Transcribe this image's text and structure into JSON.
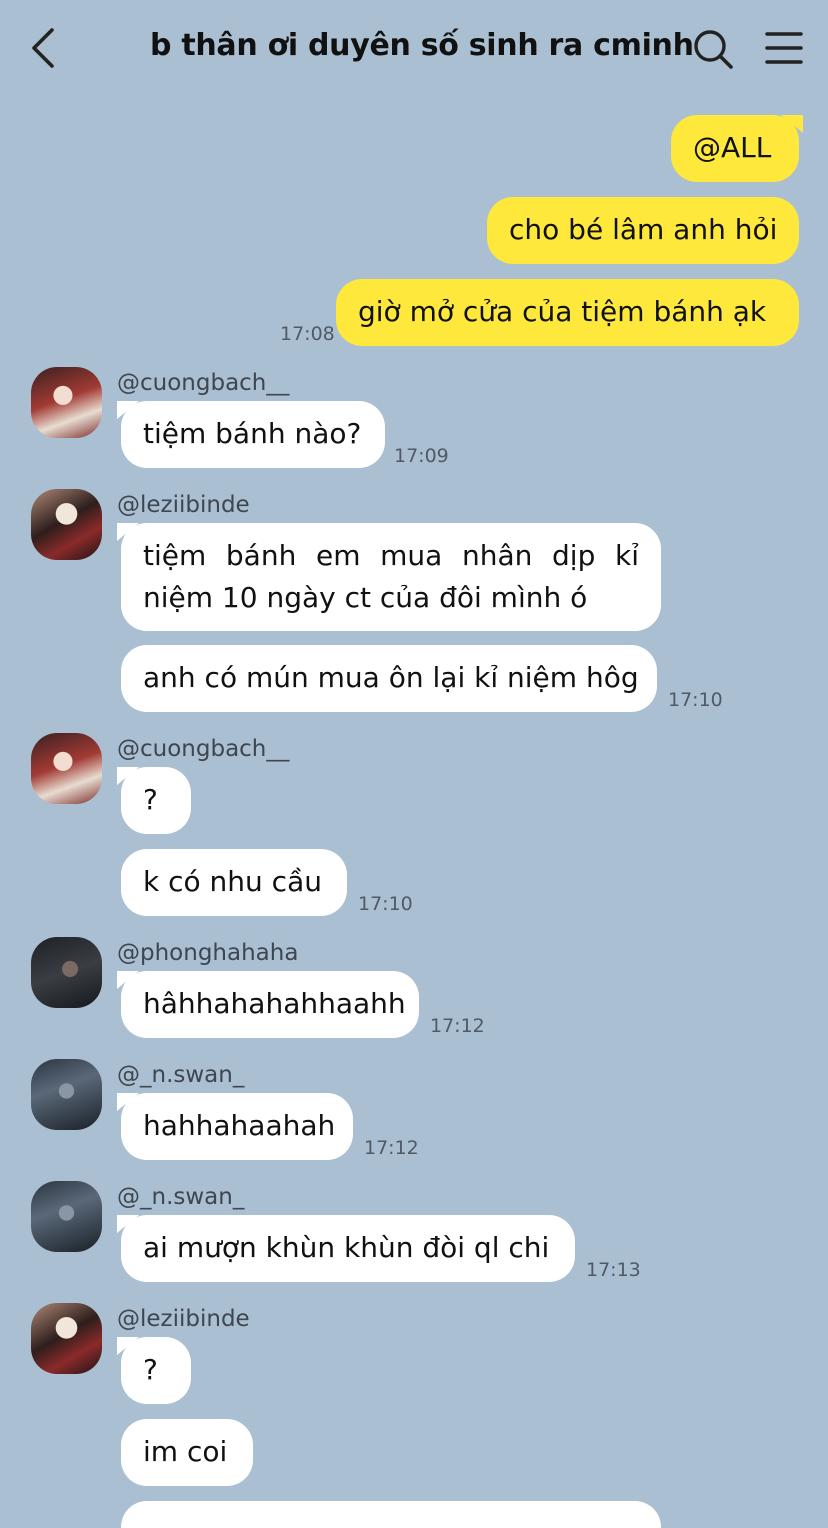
{
  "header": {
    "title": "b thân ơi duyên số sinh ra cminh"
  },
  "messages": {
    "m1": "@ALL",
    "m2": "cho bé lâm anh hỏi",
    "m3": "giờ mở cửa của tiệm bánh ạk",
    "t1": "17:08",
    "s1": "@cuongbach__",
    "m4": "tiệm bánh nào?",
    "t2": "17:09",
    "s2": "@leziibinde",
    "m5": "tiệm bánh em mua nhân dịp kỉ niệm 10 ngày ct của đôi mình ó",
    "m6": "anh có mún mua ôn lại kỉ niệm hôg",
    "t3": "17:10",
    "s3": "@cuongbach__",
    "m7": "?",
    "m8": "k có nhu cầu",
    "t4": "17:10",
    "s4": "@phonghahaha",
    "m9": "hâhhahahahhaahh",
    "t5": "17:12",
    "s5": "@_n.swan_",
    "m10": "hahhahaahah",
    "t6": "17:12",
    "s6": "@_n.swan_",
    "m11": "ai mượn khùn khùn đòi ql chi",
    "t7": "17:13",
    "s7": "@leziibinde",
    "m12": "?",
    "m13": "im coi"
  },
  "colors": {
    "background": "#aabfd2",
    "my_bubble": "#fee83c",
    "their_bubble": "#ffffff"
  },
  "icons": {
    "back": "chevron-left-icon",
    "search": "search-icon",
    "menu": "hamburger-menu-icon"
  }
}
